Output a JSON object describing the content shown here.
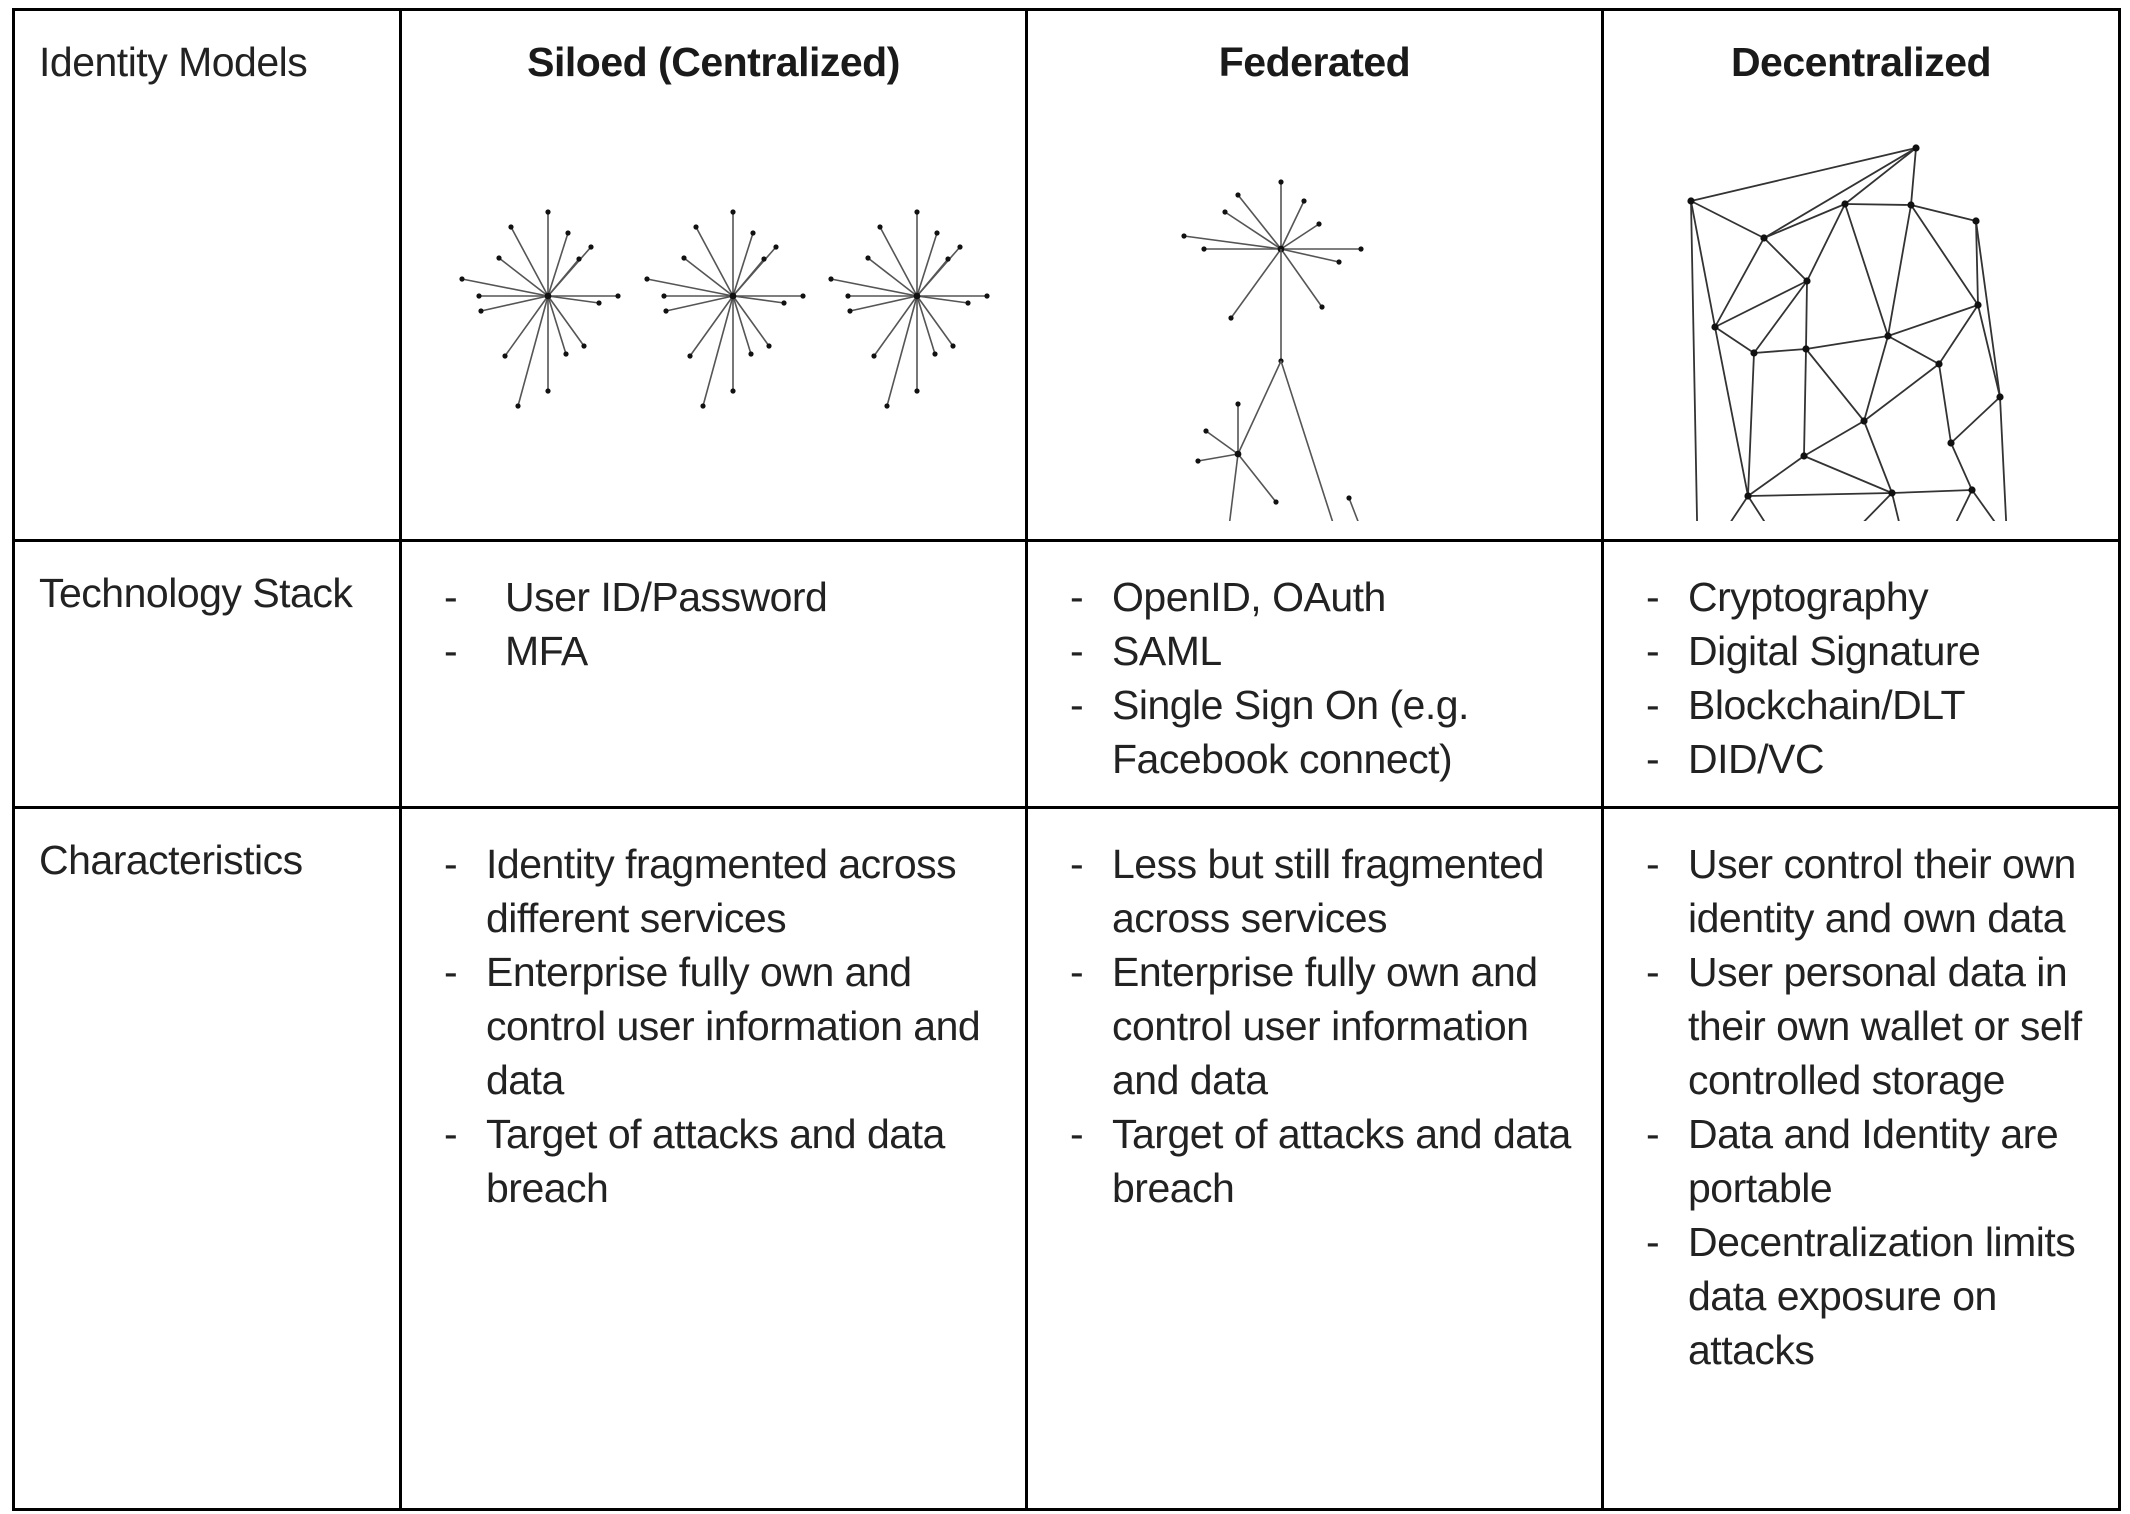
{
  "table": {
    "corner_label": "Identity Models",
    "columns": [
      {
        "title": "Siloed (Centralized)",
        "diagram": "siloed-star-networks"
      },
      {
        "title": "Federated",
        "diagram": "federated-hub-network"
      },
      {
        "title": "Decentralized",
        "diagram": "decentralized-mesh-network"
      }
    ],
    "rows": {
      "technology_stack": {
        "label": "Technology Stack",
        "siloed": [
          "User ID/Password",
          "MFA"
        ],
        "federated": [
          "OpenID, OAuth",
          "SAML",
          "Single Sign On (e.g. Facebook connect)"
        ],
        "decentralized": [
          "Cryptography",
          "Digital Signature",
          "Blockchain/DLT",
          "DID/VC"
        ]
      },
      "characteristics": {
        "label": "Characteristics",
        "siloed": [
          "Identity fragmented across different services",
          "Enterprise fully own and control user information and data",
          "Target of attacks and data breach"
        ],
        "federated": [
          "Less but still fragmented across services",
          "Enterprise fully own and control user information and data",
          "Target of attacks and data breach"
        ],
        "decentralized": [
          "User control their own identity and own data",
          "User personal data in their own wallet or self controlled storage",
          "Data and Identity are portable",
          "Decentralization limits data exposure on attacks"
        ]
      }
    },
    "bullet_marker": "-"
  }
}
